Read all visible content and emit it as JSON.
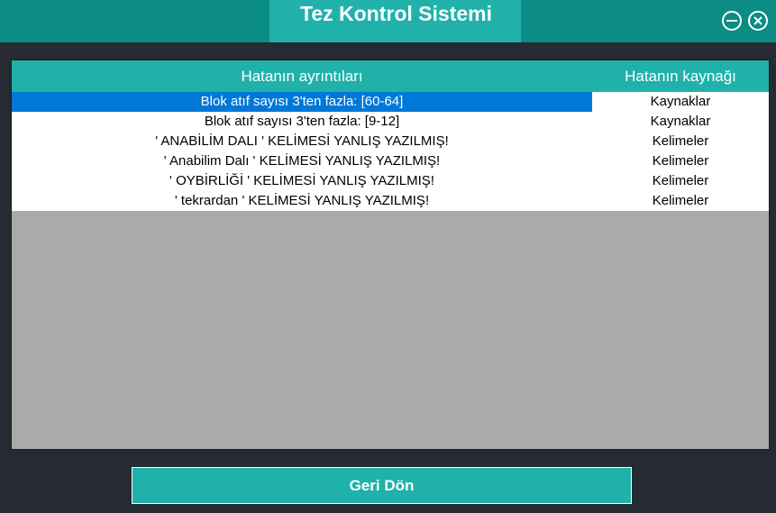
{
  "window": {
    "title": "Tez Kontrol Sistemi"
  },
  "table": {
    "columns": [
      "Hatanın ayrıntıları",
      "Hatanın kaynağı"
    ],
    "selected_row": 0,
    "rows": [
      {
        "detail": "Blok atıf sayısı 3'ten fazla: [60-64]",
        "source": "Kaynaklar"
      },
      {
        "detail": "Blok atıf sayısı 3'ten fazla: [9-12]",
        "source": "Kaynaklar"
      },
      {
        "detail": "' ANABİLİM DALI ' KELİMESİ YANLIŞ YAZILMIŞ!",
        "source": "Kelimeler"
      },
      {
        "detail": "' Anabilim Dalı ' KELİMESİ YANLIŞ YAZILMIŞ!",
        "source": "Kelimeler"
      },
      {
        "detail": "' OYBİRLİĞİ ' KELİMESİ YANLIŞ YAZILMIŞ!",
        "source": "Kelimeler"
      },
      {
        "detail": "' tekrardan ' KELİMESİ YANLIŞ YAZILMIŞ!",
        "source": "Kelimeler"
      }
    ]
  },
  "buttons": {
    "back_label": "Geri Dön"
  },
  "icons": {
    "minimize": "minimize-icon",
    "close": "close-icon"
  },
  "colors": {
    "titlebar": "#0b8c85",
    "accent": "#20b2aa",
    "background": "#252a33",
    "selection": "#0078d7",
    "grid_empty": "#aaaaaa"
  }
}
